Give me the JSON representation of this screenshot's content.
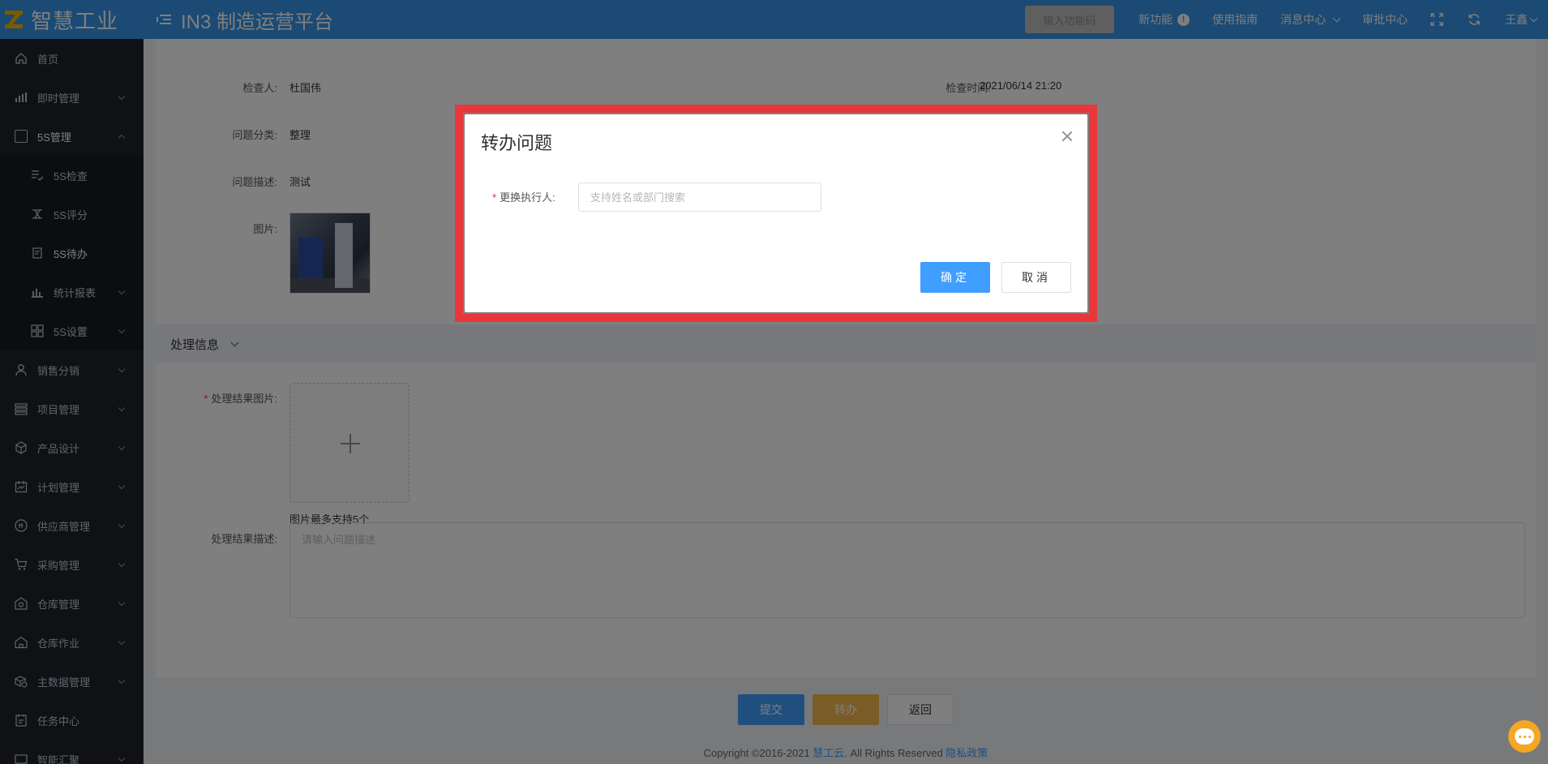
{
  "header": {
    "logo_text": "智慧工业",
    "platform_title": "IN3 制造运营平台",
    "code_button": "输入功能码",
    "new_feature": "新功能",
    "new_feature_badge": "!",
    "guide": "使用指南",
    "messages": "消息中心",
    "approval": "审批中心",
    "user": "王鑫"
  },
  "sidebar": {
    "items": [
      {
        "label": "首页",
        "icon": "home-icon"
      },
      {
        "label": "即时管理",
        "icon": "bar-chart-icon"
      },
      {
        "label": "5S管理",
        "icon": "5s-icon"
      },
      {
        "label": "5S检查",
        "icon": "checklist-icon"
      },
      {
        "label": "5S评分",
        "icon": "score-icon"
      },
      {
        "label": "5S待办",
        "icon": "todo-icon"
      },
      {
        "label": "统计报表",
        "icon": "report-icon"
      },
      {
        "label": "5S设置",
        "icon": "grid-icon"
      },
      {
        "label": "销售分销",
        "icon": "user-icon"
      },
      {
        "label": "项目管理",
        "icon": "project-icon"
      },
      {
        "label": "产品设计",
        "icon": "cube-icon"
      },
      {
        "label": "计划管理",
        "icon": "calendar-icon"
      },
      {
        "label": "供应商管理",
        "icon": "supplier-icon"
      },
      {
        "label": "采购管理",
        "icon": "cart-icon"
      },
      {
        "label": "仓库管理",
        "icon": "warehouse-icon"
      },
      {
        "label": "仓库作业",
        "icon": "warehouse-work-icon"
      },
      {
        "label": "主数据管理",
        "icon": "master-data-icon"
      },
      {
        "label": "任务中心",
        "icon": "task-icon"
      },
      {
        "label": "智能汇聚",
        "icon": "smart-icon"
      }
    ]
  },
  "detail": {
    "inspector_label": "检查人:",
    "inspector_value": "杜国伟",
    "time_label": "检查时间:",
    "time_value": "2021/06/14 21:20",
    "category_label": "问题分类:",
    "category_value": "整理",
    "desc_label": "问题描述:",
    "desc_value": "测试",
    "photo_label": "图片:"
  },
  "process": {
    "section_title": "处理信息",
    "result_image_label": "处理结果图片:",
    "upload_hint": "图片最多支持5个",
    "result_desc_label": "处理结果描述:",
    "result_desc_placeholder": "请输入问题描述"
  },
  "actions": {
    "submit": "提交",
    "transfer": "转办",
    "back": "返回"
  },
  "footer": {
    "copyright": "Copyright ©2016-2021 ",
    "company": "慧工云",
    "rights": ". All Rights Reserved ",
    "privacy": "隐私政策"
  },
  "dialog": {
    "title": "转办问题",
    "field_label": "更换执行人:",
    "field_placeholder": "支持姓名或部门搜索",
    "field_value": "",
    "ok": "确定",
    "cancel": "取消"
  },
  "colors": {
    "header_bg": "#3794e8",
    "sidebar_bg": "#1f2329",
    "primary": "#409eff",
    "warning": "#f4b84e",
    "highlight": "#e8363a"
  }
}
